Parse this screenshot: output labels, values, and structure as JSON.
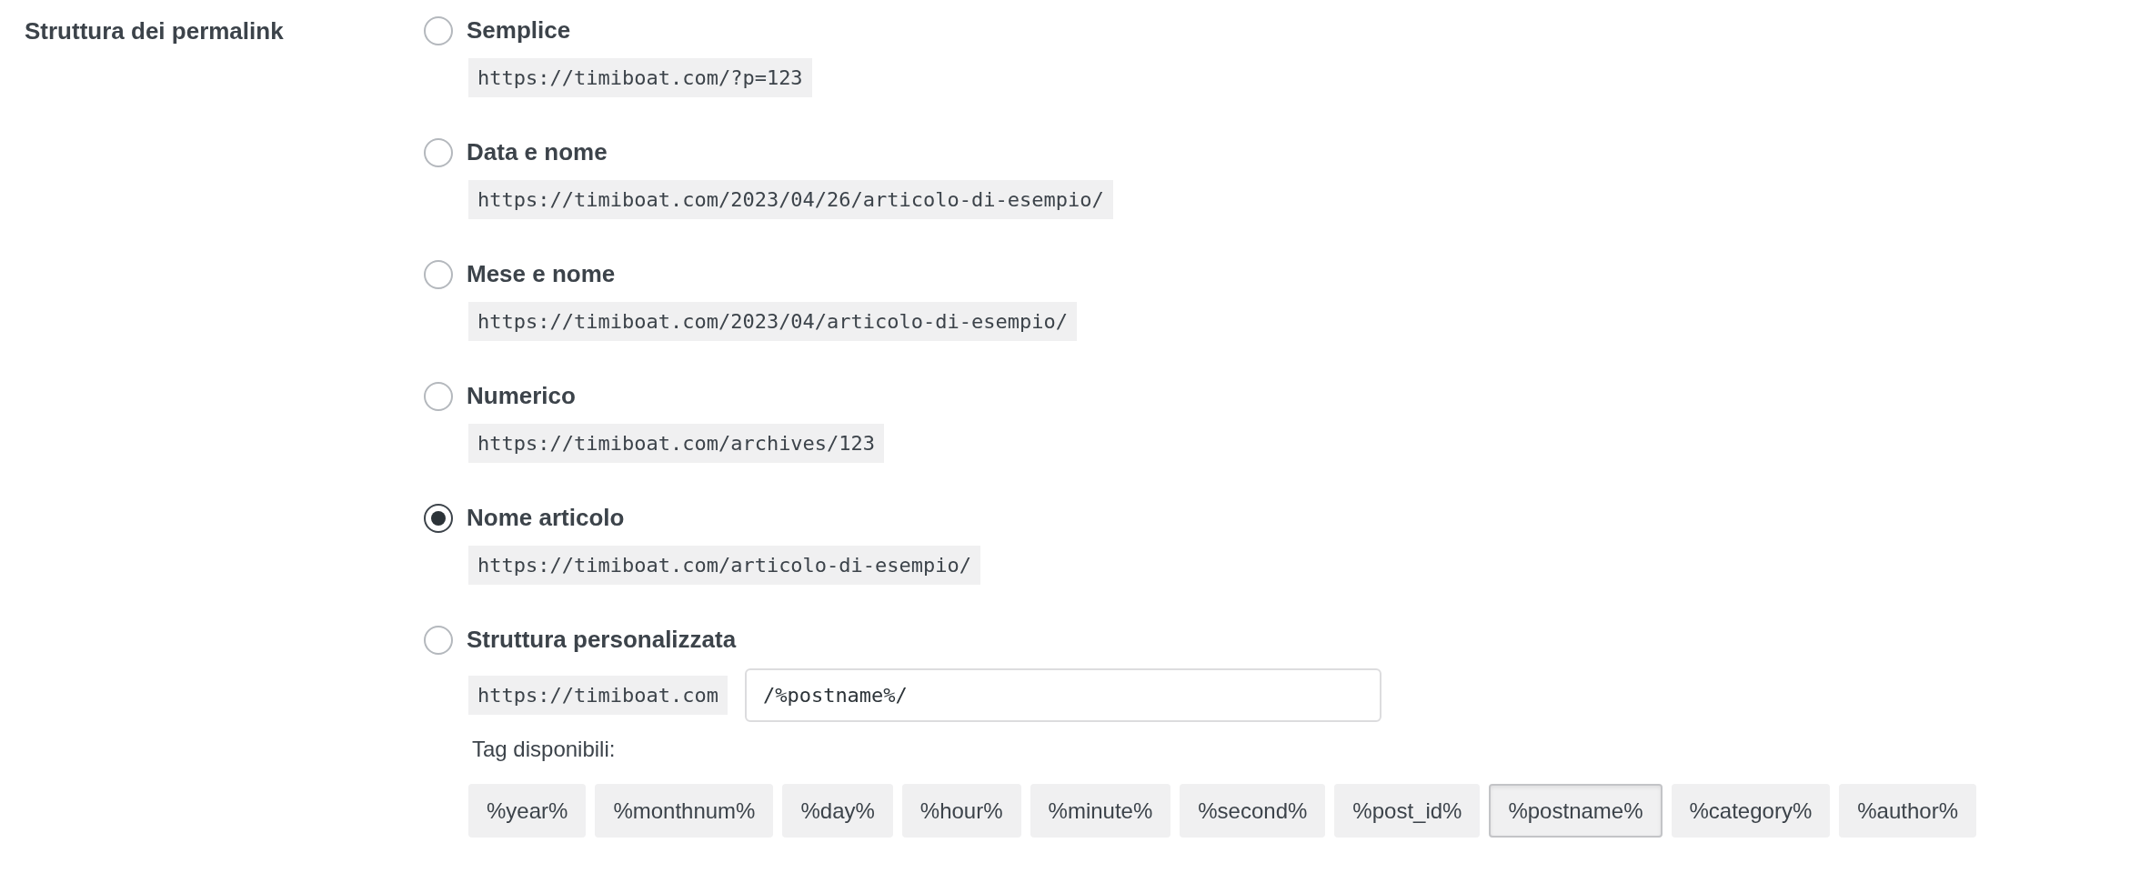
{
  "section_label": "Struttura dei permalink",
  "options": [
    {
      "label": "Semplice",
      "selected": false,
      "example": "https://timiboat.com/?p=123"
    },
    {
      "label": "Data e nome",
      "selected": false,
      "example": "https://timiboat.com/2023/04/26/articolo-di-esempio/"
    },
    {
      "label": "Mese e nome",
      "selected": false,
      "example": "https://timiboat.com/2023/04/articolo-di-esempio/"
    },
    {
      "label": "Numerico",
      "selected": false,
      "example": "https://timiboat.com/archives/123"
    },
    {
      "label": "Nome articolo",
      "selected": true,
      "example": "https://timiboat.com/articolo-di-esempio/"
    },
    {
      "label": "Struttura personalizzata",
      "selected": false,
      "base": "https://timiboat.com",
      "value": "/%postname%/"
    }
  ],
  "tags_label": "Tag disponibili:",
  "tags": [
    {
      "label": "%year%",
      "selected": false
    },
    {
      "label": "%monthnum%",
      "selected": false
    },
    {
      "label": "%day%",
      "selected": false
    },
    {
      "label": "%hour%",
      "selected": false
    },
    {
      "label": "%minute%",
      "selected": false
    },
    {
      "label": "%second%",
      "selected": false
    },
    {
      "label": "%post_id%",
      "selected": false
    },
    {
      "label": "%postname%",
      "selected": true
    },
    {
      "label": "%category%",
      "selected": false
    },
    {
      "label": "%author%",
      "selected": false
    }
  ]
}
